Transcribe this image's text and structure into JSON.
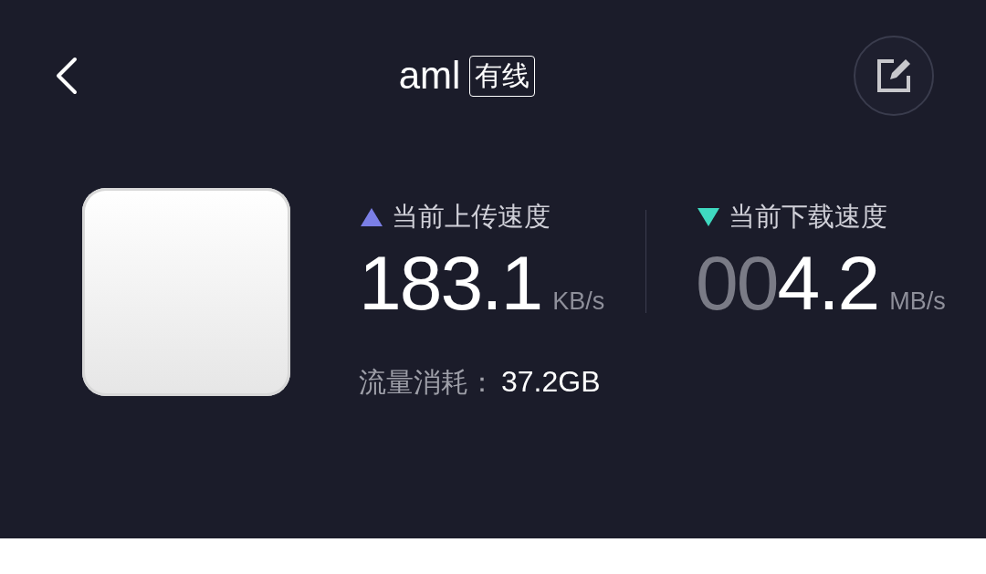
{
  "header": {
    "title": "aml",
    "tag": "有线"
  },
  "stats": [
    {
      "kind": "upload",
      "label": "当前上传速度",
      "value": "183.1",
      "unit": "KB/s",
      "color": "#7b7fe6"
    },
    {
      "kind": "download",
      "label": "当前下载速度",
      "value": "004.2",
      "unit": "MB/s",
      "color": "#3fd9c0"
    }
  ],
  "usage": {
    "label": "流量消耗：",
    "value": "37.2GB"
  }
}
